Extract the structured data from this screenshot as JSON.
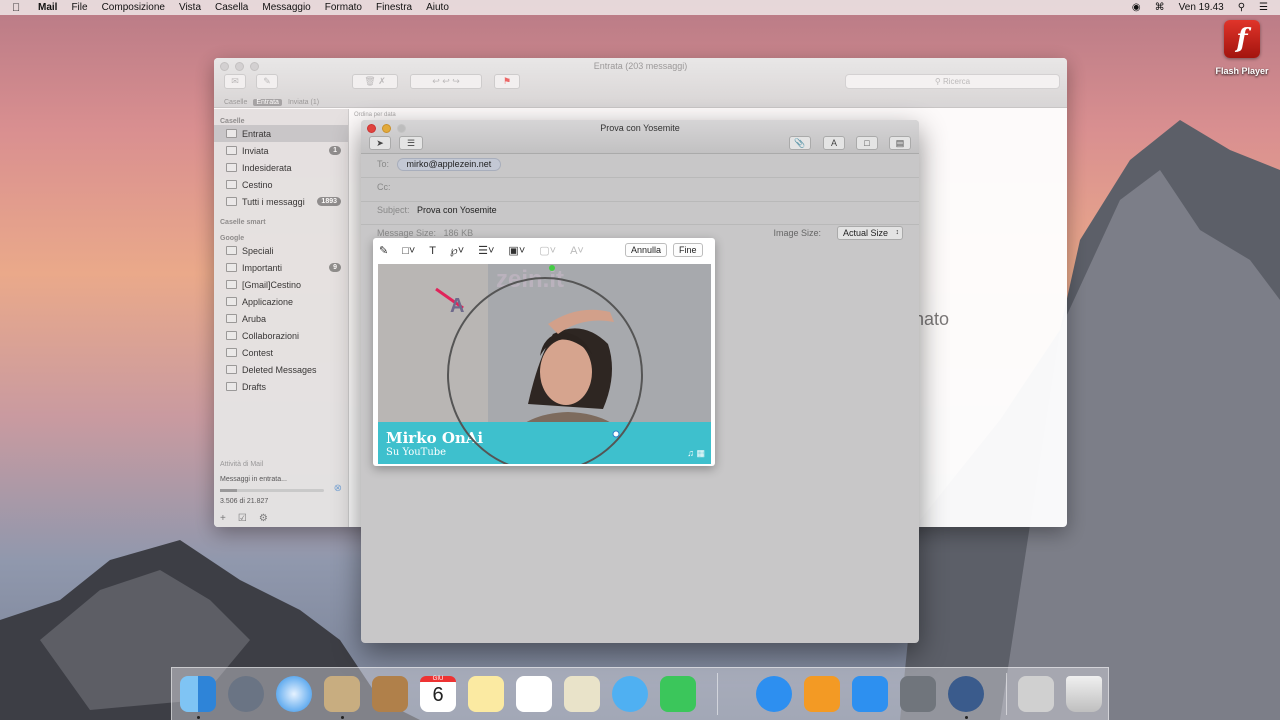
{
  "menubar": {
    "items": [
      "Mail",
      "File",
      "Composizione",
      "Vista",
      "Casella",
      "Messaggio",
      "Formato",
      "Finestra",
      "Aiuto"
    ],
    "clock": "Ven 19.43"
  },
  "desktop": {
    "flash_label": "Flash Player"
  },
  "mail": {
    "title": "Entrata (203 messaggi)",
    "search_placeholder": "Ricerca",
    "favorites": [
      "Caselle",
      "Entrata",
      "Inviata (1)"
    ],
    "sort_label": "Ordina per data",
    "reading_text": "nato",
    "sidebar": {
      "section_mailboxes": "Caselle",
      "mailboxes": [
        {
          "label": "Entrata",
          "badge": ""
        },
        {
          "label": "Inviata",
          "badge": "1"
        },
        {
          "label": "Indesiderata",
          "badge": ""
        },
        {
          "label": "Cestino",
          "badge": ""
        },
        {
          "label": "Tutti i messaggi",
          "badge": "1893"
        }
      ],
      "section_smart": "Caselle smart",
      "section_google": "Google",
      "google": [
        {
          "label": "Speciali",
          "badge": ""
        },
        {
          "label": "Importanti",
          "badge": "9"
        },
        {
          "label": "[Gmail]Cestino",
          "badge": ""
        },
        {
          "label": "Applicazione",
          "badge": ""
        },
        {
          "label": "Aruba",
          "badge": ""
        },
        {
          "label": "Collaborazioni",
          "badge": ""
        },
        {
          "label": "Contest",
          "badge": ""
        },
        {
          "label": "Deleted Messages",
          "badge": ""
        },
        {
          "label": "Drafts",
          "badge": ""
        }
      ],
      "activity_title": "Attività di Mail",
      "activity_text": "Messaggi in entrata...",
      "activity_count": "3.506 di 21.827",
      "activity_progress": 0.16
    }
  },
  "compose": {
    "title": "Prova con Yosemite",
    "to_label": "To:",
    "to_value": "mirko@applezein.net",
    "cc_label": "Cc:",
    "subject_label": "Subject:",
    "subject_value": "Prova con Yosemite",
    "size_label": "Message Size:",
    "size_value": "186 KB",
    "image_size_label": "Image Size:",
    "image_size_value": "Actual Size",
    "markup": {
      "cancel_label": "Annulla",
      "done_label": "Fine",
      "text_tool": "T",
      "photo_title": "Mirko OnAi",
      "photo_subtitle": "Su YouTube",
      "watermark": "zein.it"
    }
  },
  "dock": {
    "calendar_month": "GIU",
    "calendar_day": "6"
  }
}
